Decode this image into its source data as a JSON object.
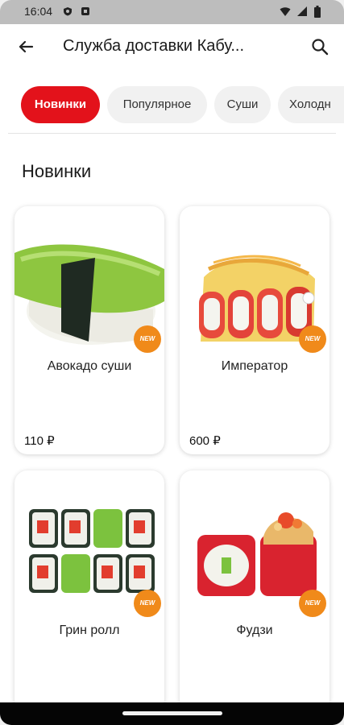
{
  "status_bar": {
    "time": "16:04"
  },
  "app_bar": {
    "title": "Служба доставки Кабу..."
  },
  "tabs": [
    {
      "label": "Новинки",
      "active": true
    },
    {
      "label": "Популярное",
      "active": false
    },
    {
      "label": "Суши",
      "active": false
    },
    {
      "label": "Холодн",
      "active": false
    }
  ],
  "section": {
    "title": "Новинки"
  },
  "products": [
    {
      "name": "Авокадо суши",
      "price": "110 ₽",
      "badge": "NEW"
    },
    {
      "name": "Император",
      "price": "600 ₽",
      "badge": "NEW"
    },
    {
      "name": "Грин ролл",
      "price": "",
      "badge": "NEW"
    },
    {
      "name": "Фудзи",
      "price": "",
      "badge": "NEW"
    }
  ],
  "colors": {
    "accent": "#e3121b",
    "badge": "#f08a1a",
    "status_bar": "#bdbdbd"
  },
  "icons": {
    "back": "arrow-left",
    "search": "magnifier"
  }
}
